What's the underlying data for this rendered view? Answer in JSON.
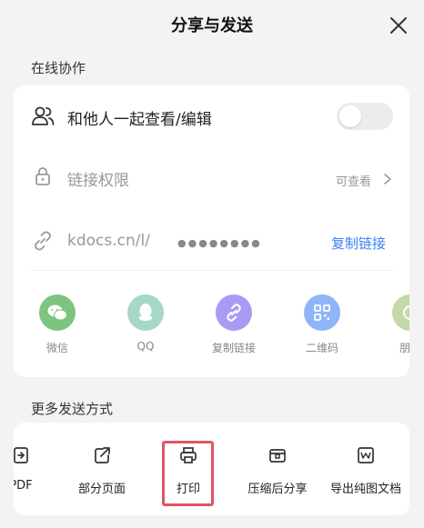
{
  "header": {
    "title": "分享与发送"
  },
  "online_section": {
    "label": "在线协作"
  },
  "collab": {
    "label": "和他人一起查看/编辑",
    "enabled": false
  },
  "permission": {
    "label": "链接权限",
    "value": "可查看"
  },
  "link": {
    "prefix": "kdocs.cn/l/",
    "masked": "●●●●●●●●",
    "copy_label": "复制链接"
  },
  "share_targets": [
    {
      "label": "微信",
      "icon": "wechat-icon",
      "color": "#7cc47f"
    },
    {
      "label": "QQ",
      "icon": "qq-icon",
      "color": "#a7d7c5"
    },
    {
      "label": "复制链接",
      "icon": "link-icon",
      "color": "#a99bf3"
    },
    {
      "label": "二维码",
      "icon": "qrcode-icon",
      "color": "#8fb5f8"
    },
    {
      "label": "朋友",
      "icon": "moments-icon",
      "color": "#c3d9a7"
    }
  ],
  "more_section": {
    "label": "更多发送方式"
  },
  "more_options": [
    {
      "label": "PDF",
      "icon": "pdf-export-icon"
    },
    {
      "label": "部分页面",
      "icon": "partial-page-share-icon"
    },
    {
      "label": "打印",
      "icon": "printer-icon",
      "highlighted": true
    },
    {
      "label": "压缩后分享",
      "icon": "compress-icon"
    },
    {
      "label": "导出纯图文档",
      "icon": "image-doc-icon"
    }
  ],
  "colors": {
    "accent": "#3b82f6",
    "highlight": "#e25461",
    "background": "#f3f3f5"
  }
}
